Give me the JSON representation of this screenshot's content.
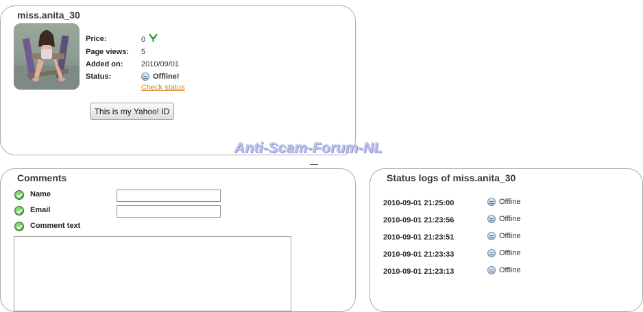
{
  "profile": {
    "username": "miss.anita_30",
    "price_label": "Price:",
    "price_value": "0",
    "page_views_label": "Page views:",
    "page_views_value": "5",
    "added_on_label": "Added on:",
    "added_on_value": "2010/09/01",
    "status_label": "Status:",
    "status_value": "Offline!",
    "check_status_link": "Check status",
    "yahoo_button": "This is my Yahoo! ID"
  },
  "watermark": "Anti-Scam-Forum-NL",
  "comments": {
    "title": "Comments",
    "name_label": "Name",
    "email_label": "Email",
    "comment_label": "Comment text",
    "name_value": "",
    "email_value": ""
  },
  "status_logs": {
    "title": "Status logs of miss.anita_30",
    "entries": [
      {
        "time": "2010-09-01 21:25:00",
        "status": "Offline"
      },
      {
        "time": "2010-09-01 21:23:56",
        "status": "Offline"
      },
      {
        "time": "2010-09-01 21:23:51",
        "status": "Offline"
      },
      {
        "time": "2010-09-01 21:23:33",
        "status": "Offline"
      },
      {
        "time": "2010-09-01 21:23:13",
        "status": "Offline"
      }
    ]
  },
  "colors": {
    "link": "#d77b00",
    "border": "#a9a9a9",
    "check_green": "#3c9a2e",
    "price_icon_green": "#1f9a1f",
    "watermark": "#b9bde8"
  },
  "icons": {
    "status": "offline-status-icon",
    "price": "green-currency-icon",
    "field": "green-check-icon"
  }
}
